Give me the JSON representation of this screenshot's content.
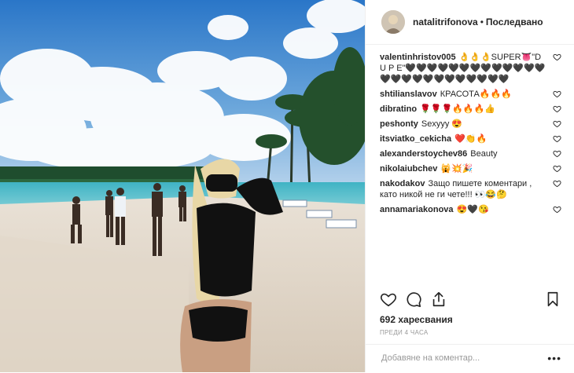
{
  "header": {
    "username": "natalitrifonova",
    "separator": "•",
    "follow_status": "Последвано"
  },
  "comments": [
    {
      "user": "valentinhristov005",
      "text": "👌👌👌SUPER👅\"D U P E\"🖤🖤🖤🖤🖤🖤🖤🖤🖤🖤🖤🖤🖤🖤🖤🖤🖤🖤🖤🖤🖤🖤🖤🖤🖤"
    },
    {
      "user": "shtilianslavov",
      "text": "КРАСОТА🔥🔥🔥"
    },
    {
      "user": "dibratino",
      "text": "🌹🌹🌹🔥🔥🔥👍"
    },
    {
      "user": "peshonty",
      "text": "Sexyyy 😍"
    },
    {
      "user": "itsviatko_cekicha",
      "text": "❤️👏🔥"
    },
    {
      "user": "alexanderstoychev86",
      "text": "Beauty"
    },
    {
      "user": "nikolaiubchev",
      "text": "🙀💥🎉"
    },
    {
      "user": "nakodakov",
      "text": "Защо пишете коментари , като никой не ги чете!!! 👀😂🤔"
    },
    {
      "user": "annamariakonova",
      "text": "😍🖤😘"
    }
  ],
  "likes": "692 харесвания",
  "time_ago": "ПРЕДИ 4 ЧАСА",
  "add_comment": {
    "placeholder": "Добавяне на коментар..."
  },
  "more_label": "•••",
  "icons": {
    "like": "heart-icon",
    "comment": "comment-icon",
    "share": "share-icon",
    "save": "bookmark-icon"
  }
}
